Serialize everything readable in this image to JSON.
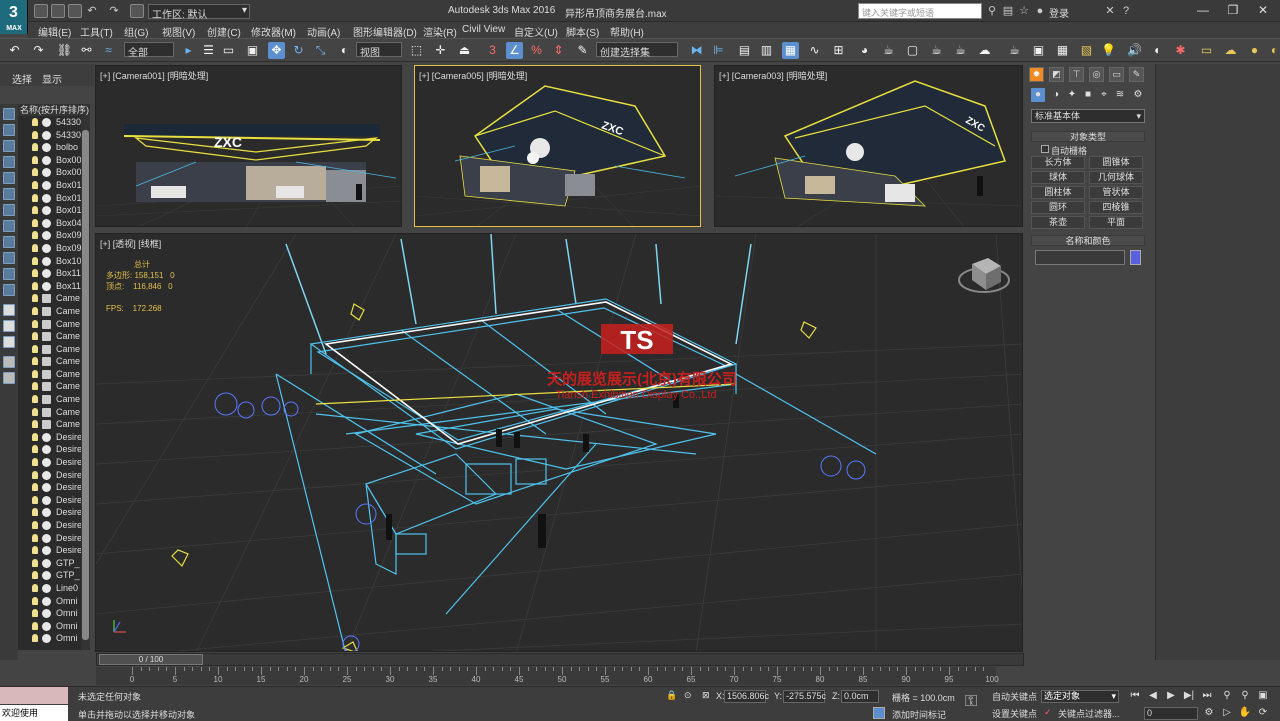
{
  "titlebar": {
    "logo": "3",
    "logo_sub": "MAX",
    "workspace_label": "工作区: 默认",
    "app_title": "Autodesk 3ds Max 2016",
    "file_title": "异形吊顶商务展台.max",
    "search_placeholder": "键入关键字或短语",
    "login_label": "登录",
    "help_symbol": "?"
  },
  "menus": [
    "编辑(E)",
    "工具(T)",
    "组(G)",
    "视图(V)",
    "创建(C)",
    "修改器(M)",
    "动画(A)",
    "图形编辑器(D)",
    "渲染(R)",
    "Civil View",
    "自定义(U)",
    "脚本(S)",
    "帮助(H)"
  ],
  "toolbar": {
    "selection_filter": "全部",
    "ref_coord": "视图",
    "named_selection": "创建选择集"
  },
  "scene_explorer": {
    "tabs": [
      "选择",
      "显示"
    ],
    "header": "名称(按升序排序)",
    "items": [
      {
        "name": "54330",
        "type": "box"
      },
      {
        "name": "54330",
        "type": "box"
      },
      {
        "name": "bolbo",
        "type": "sphere"
      },
      {
        "name": "Box00",
        "type": "sphere"
      },
      {
        "name": "Box00",
        "type": "sphere"
      },
      {
        "name": "Box01",
        "type": "sphere"
      },
      {
        "name": "Box01",
        "type": "sphere"
      },
      {
        "name": "Box01",
        "type": "sphere"
      },
      {
        "name": "Box04",
        "type": "sphere"
      },
      {
        "name": "Box09",
        "type": "sphere"
      },
      {
        "name": "Box09",
        "type": "sphere"
      },
      {
        "name": "Box10",
        "type": "sphere"
      },
      {
        "name": "Box11",
        "type": "sphere"
      },
      {
        "name": "Box11",
        "type": "sphere"
      },
      {
        "name": "Came",
        "type": "cam"
      },
      {
        "name": "Came",
        "type": "cam"
      },
      {
        "name": "Came",
        "type": "cam"
      },
      {
        "name": "Came",
        "type": "cam"
      },
      {
        "name": "Came",
        "type": "cam"
      },
      {
        "name": "Came",
        "type": "cam"
      },
      {
        "name": "Came",
        "type": "cam"
      },
      {
        "name": "Came",
        "type": "cam"
      },
      {
        "name": "Came",
        "type": "cam"
      },
      {
        "name": "Came",
        "type": "cam"
      },
      {
        "name": "Came",
        "type": "cam"
      },
      {
        "name": "Desire",
        "type": "sphere"
      },
      {
        "name": "Desire",
        "type": "sphere"
      },
      {
        "name": "Desire",
        "type": "sphere"
      },
      {
        "name": "Desire",
        "type": "sphere"
      },
      {
        "name": "Desire",
        "type": "sphere"
      },
      {
        "name": "Desire",
        "type": "sphere"
      },
      {
        "name": "Desire",
        "type": "sphere"
      },
      {
        "name": "Desire",
        "type": "sphere"
      },
      {
        "name": "Desire",
        "type": "sphere"
      },
      {
        "name": "Desire",
        "type": "sphere"
      },
      {
        "name": "GTP_",
        "type": "sphere"
      },
      {
        "name": "GTP_",
        "type": "sphere"
      },
      {
        "name": "Line0",
        "type": "sphere"
      },
      {
        "name": "Omni",
        "type": "sphere"
      },
      {
        "name": "Omni",
        "type": "sphere"
      },
      {
        "name": "Omni",
        "type": "sphere"
      },
      {
        "name": "Omni",
        "type": "sphere"
      }
    ]
  },
  "viewports": {
    "cam1": "[+] [Camera001] [明暗处理]",
    "cam5": "[+] [Camera005] [明暗处理]",
    "cam3": "[+] [Camera003] [明暗处理]",
    "persp": "[+] [透视] [线框]",
    "logo_text": "ZXC",
    "stats": {
      "total_label": "总计",
      "poly_label": "多边形:",
      "poly_value": "158,151",
      "poly_sel": "0",
      "vert_label": "顶点:",
      "vert_value": "116,846",
      "vert_sel": "0",
      "fps_label": "FPS:",
      "fps_value": "172.268"
    },
    "watermark_cn": "天的展览展示(北京)有限公司",
    "watermark_en": "Tiansh Exhibition Display Co.,Ltd",
    "watermark_logo": "TS"
  },
  "command_panel": {
    "type_dropdown": "标准基本体",
    "rollout_object_type": "对象类型",
    "autogrid_label": "自动栅格",
    "buttons": [
      "长方体",
      "圆锥体",
      "球体",
      "几何球体",
      "圆柱体",
      "管状体",
      "圆环",
      "四棱锥",
      "茶壶",
      "平面"
    ],
    "rollout_name_color": "名称和颜色",
    "name_value": "",
    "color": "#5b60e0"
  },
  "timeline": {
    "frame_display": "0 / 100",
    "ticks": [
      "0",
      "5",
      "10",
      "15",
      "20",
      "25",
      "30",
      "35",
      "40",
      "45",
      "50",
      "55",
      "60",
      "65",
      "70",
      "75",
      "80",
      "85",
      "90",
      "95",
      "100"
    ]
  },
  "statusbar": {
    "maxscript_label": "欢迎使用 MAXSc",
    "status_line1": "未选定任何对象",
    "status_line2": "单击并拖动以选择并移动对象",
    "x_label": "X:",
    "x_value": "1506.806c",
    "y_label": "Y:",
    "y_value": "-275.575c",
    "z_label": "Z:",
    "z_value": "0.0cm",
    "grid": "栅格 = 100.0cm",
    "add_time_tag": "添加时间标记",
    "auto_key": "自动关键点",
    "set_key": "设置关键点",
    "key_filter": "选定对象",
    "key_filters_btn": "关键点过滤器...",
    "frame_value": "0"
  }
}
